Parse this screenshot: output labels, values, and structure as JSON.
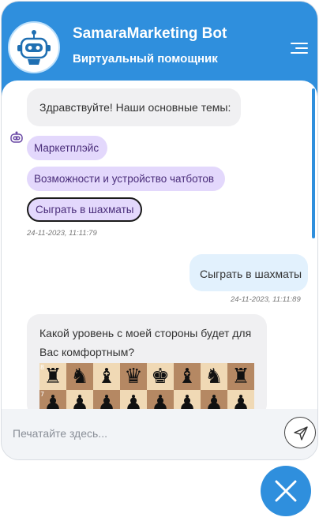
{
  "header": {
    "bot_name": "SamaraMarketing Bot",
    "subtitle": "Виртуальный помощник",
    "avatar_icon": "robot-icon",
    "menu_icon": "hamburger-menu-icon"
  },
  "messages": {
    "greeting": "Здравствуйте! Наши основные темы:",
    "options": [
      "Маркетплэйс",
      "Возможности и устройство чатботов",
      "Сыграть в шахматы"
    ],
    "greeting_time": "24-11-2023, 11:11:79",
    "user_message": "Сыграть в шахматы",
    "user_time": "24-11-2023, 11:11:89",
    "question_line1": "Какой уровень с моей стороны будет для",
    "question_line2": "Вас комфортным?",
    "board_rank_8": "8",
    "board_rank_7": "7"
  },
  "input": {
    "placeholder": "Печатайте здесь...",
    "send_icon": "send-icon"
  },
  "fab": {
    "icon": "close-icon"
  },
  "colors": {
    "primary": "#2f8fdd",
    "chip": "#e3d8fc",
    "user_bubble": "#e2f1fd",
    "bot_bubble": "#f0f0f2"
  }
}
